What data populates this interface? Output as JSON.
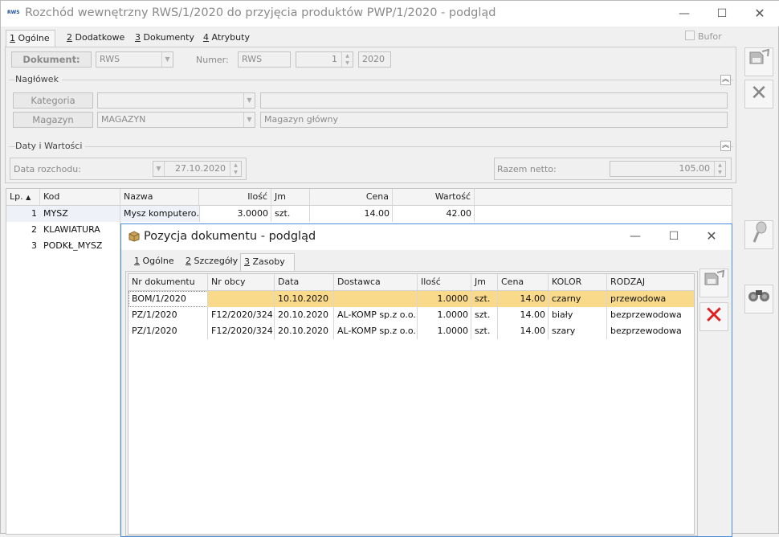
{
  "window": {
    "title": "Rozchód wewnętrzny RWS/1/2020 do przyjęcia produktów PWP/1/2020 - podgląd",
    "icon_label": "RWS",
    "minimize": "—",
    "maximize": "☐",
    "close": "✕"
  },
  "tabs": [
    {
      "num": "1",
      "label": " Ogólne"
    },
    {
      "num": "2",
      "label": " Dodatkowe"
    },
    {
      "num": "3",
      "label": " Dokumenty"
    },
    {
      "num": "4",
      "label": " Atrybuty"
    }
  ],
  "bufor": "Bufor",
  "document": {
    "button": "Dokument:",
    "type_value": "RWS",
    "number_label": "Numer:",
    "series": "RWS",
    "number": "1",
    "year": "2020"
  },
  "naglowek": {
    "title": "Nagłówek",
    "kategoria_btn": "Kategoria",
    "magazyn_btn": "Magazyn",
    "magazyn_value": "MAGAZYN",
    "magazyn_desc": "Magazyn główny"
  },
  "daty": {
    "title": "Daty i Wartości",
    "data_label": "Data rozchodu:",
    "data_value": "27.10.2020",
    "razem_label": "Razem netto:",
    "razem_value": "105.00"
  },
  "items_grid": {
    "headers": [
      "Lp.",
      "Kod",
      "Nazwa",
      "Ilość",
      "Jm",
      "Cena",
      "Wartość"
    ],
    "rows": [
      {
        "lp": "1",
        "kod": "MYSZ",
        "nazwa": "Mysz komputero…",
        "ilosc": "3.0000",
        "jm": "szt.",
        "cena": "14.00",
        "wartosc": "42.00"
      },
      {
        "lp": "2",
        "kod": "KLAWIATURA"
      },
      {
        "lp": "3",
        "kod": "PODKŁ_MYSZ"
      }
    ]
  },
  "dialog": {
    "title": "Pozycja dokumentu - podgląd",
    "minimize": "—",
    "maximize": "☐",
    "close": "✕",
    "tabs": [
      {
        "num": "1",
        "label": " Ogólne"
      },
      {
        "num": "2",
        "label": " Szczegóły"
      },
      {
        "num": "3",
        "label": " Zasoby"
      }
    ],
    "grid": {
      "headers": [
        "Nr dokumentu",
        "Nr obcy",
        "Data",
        "Dostawca",
        "Ilość",
        "Jm",
        "Cena",
        "KOLOR",
        "RODZAJ"
      ],
      "rows": [
        [
          "BOM/1/2020",
          "",
          "10.10.2020",
          "",
          "1.0000",
          "szt.",
          "14.00",
          "czarny",
          "przewodowa"
        ],
        [
          "PZ/1/2020",
          "F12/2020/324",
          "20.10.2020",
          "AL-KOMP sp.z o.o.",
          "1.0000",
          "szt.",
          "14.00",
          "biały",
          "bezprzewodowa"
        ],
        [
          "PZ/1/2020",
          "F12/2020/324",
          "20.10.2020",
          "AL-KOMP sp.z o.o.",
          "1.0000",
          "szt.",
          "14.00",
          "szary",
          "bezprzewodowa"
        ]
      ]
    }
  },
  "colors": {
    "selected_row": "#f9d98a",
    "dialog_border": "#4a8fd9",
    "delete_red": "#e02020"
  }
}
